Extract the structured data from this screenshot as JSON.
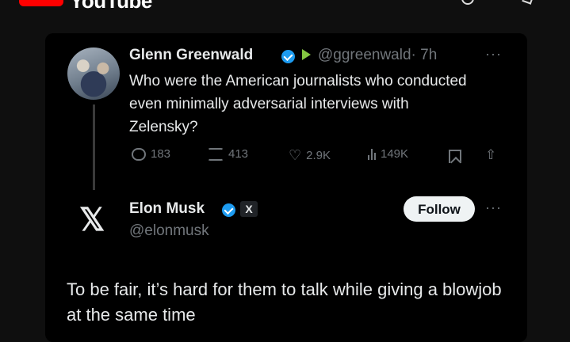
{
  "app": {
    "name": "YouTube"
  },
  "tweet": {
    "author_name": "Glenn Greenwald",
    "author_handle": "@ggreenwald",
    "time": "· 7h",
    "text": "Who were the American journalists who conducted even minimally adversarial interviews with Zelensky?",
    "stats": {
      "replies": "183",
      "retweets": "413",
      "likes": "2.9K",
      "views": "149K"
    },
    "more": "···"
  },
  "reply": {
    "author_name": "Elon Musk",
    "author_handle": "@elonmusk",
    "badge": "X",
    "follow_label": "Follow",
    "more": "···",
    "logo": "𝕏",
    "text": "To be fair, it’s hard for them to talk while giving a blowjob at the same time"
  },
  "colors": {
    "accent": "#1d9bf0",
    "muted": "#71767b",
    "text": "#e7e9ea",
    "rumble": "#85c742"
  }
}
